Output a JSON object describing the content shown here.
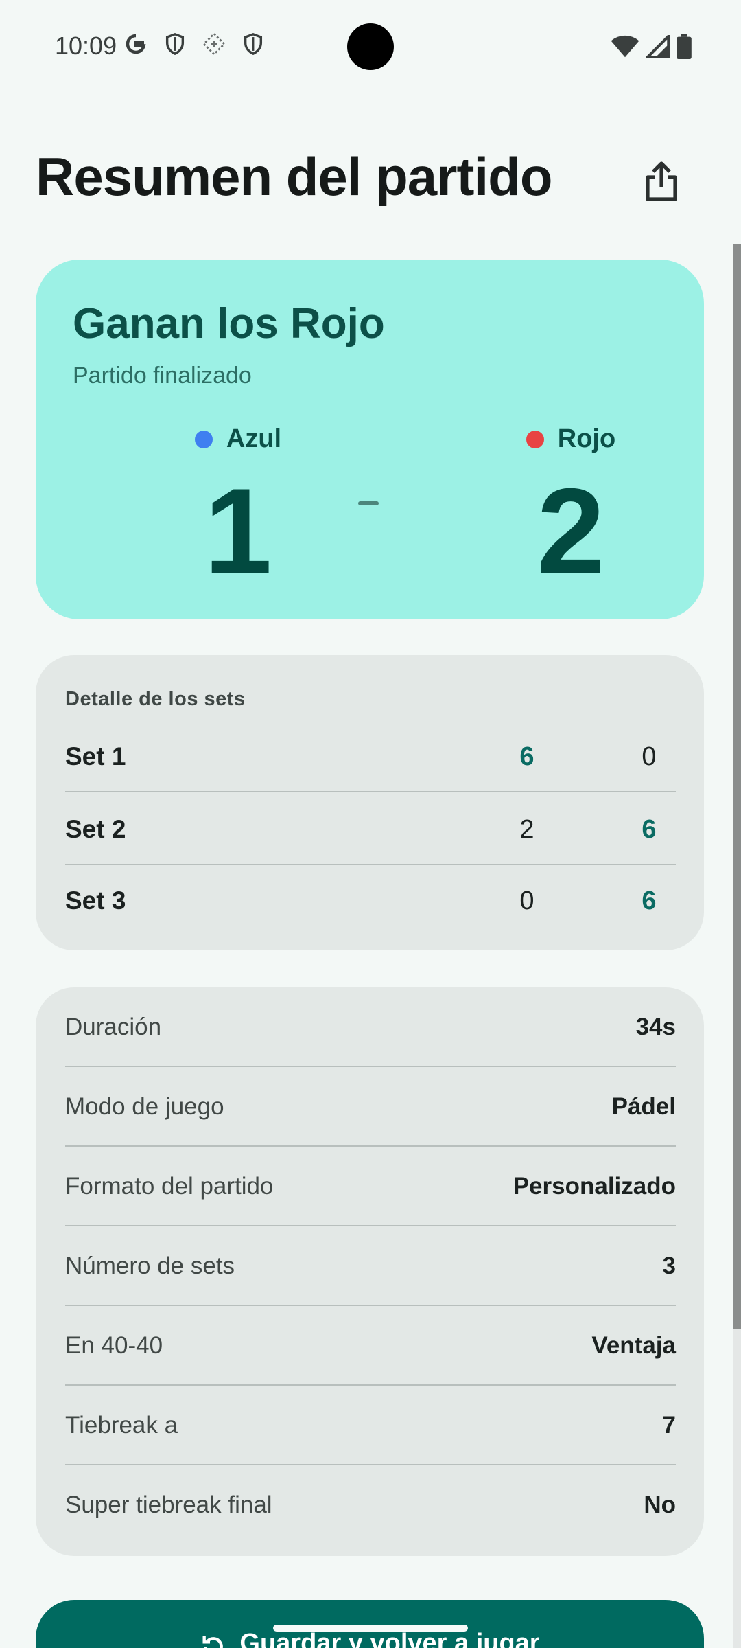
{
  "status_bar": {
    "time": "10:09",
    "left_icons": [
      "google-icon",
      "shield-icon",
      "data-saver-icon",
      "shield-icon"
    ],
    "right_icons": [
      "wifi-icon",
      "signal-icon",
      "battery-icon"
    ]
  },
  "header": {
    "title": "Resumen del partido",
    "share_icon": "share-icon"
  },
  "result": {
    "winner_text": "Ganan los Rojo",
    "status_text": "Partido finalizado",
    "team_blue": {
      "name": "Azul",
      "score": "1",
      "color": "#3f7ff0"
    },
    "team_red": {
      "name": "Rojo",
      "score": "2",
      "color": "#e84343"
    }
  },
  "sets": {
    "heading": "Detalle de los sets",
    "rows": [
      {
        "name": "Set 1",
        "blue": "6",
        "red": "0"
      },
      {
        "name": "Set 2",
        "blue": "2",
        "red": "6"
      },
      {
        "name": "Set 3",
        "blue": "0",
        "red": "6"
      }
    ]
  },
  "info": {
    "rows": [
      {
        "label": "Duración",
        "value": "34s"
      },
      {
        "label": "Modo de juego",
        "value": "Pádel"
      },
      {
        "label": "Formato del partido",
        "value": "Personalizado"
      },
      {
        "label": "Número de sets",
        "value": "3"
      },
      {
        "label": "En 40-40",
        "value": "Ventaja"
      },
      {
        "label": "Tiebreak a",
        "value": "7"
      },
      {
        "label": "Super tiebreak final",
        "value": "No"
      }
    ]
  },
  "actions": {
    "primary_label": "Guardar y volver a jugar",
    "primary_icon": "replay-icon"
  },
  "colors": {
    "accent": "#006a60",
    "winner_card": "#9cf1e5",
    "win_value": "#0a6b63"
  }
}
